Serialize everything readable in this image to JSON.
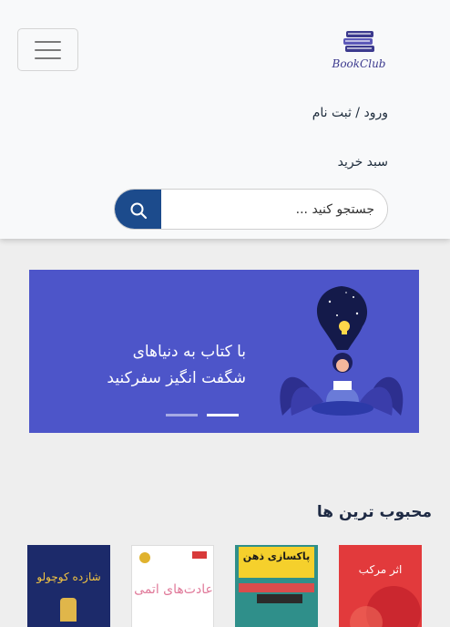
{
  "brand": {
    "logo_text": "BookClub",
    "logo_color": "#3c3a8e"
  },
  "nav": {
    "login_label": "ورود / ثبت نام",
    "cart_label": "سبد خرید"
  },
  "search": {
    "placeholder": "جستجو کنید ...",
    "value": ""
  },
  "banner": {
    "line1": "با کتاب به دنیاهای",
    "line2": "شگفت انگیز سفرکنید",
    "background": "#4d55c9",
    "slide_count": 2,
    "active_slide": 2
  },
  "section": {
    "title": "محبوب ترین ها"
  },
  "books": [
    {
      "title": "اثر مرکب",
      "cover_color": "#e23a3c"
    },
    {
      "title": "پاکسازی ذهن",
      "cover_color": "#2f8f8a"
    },
    {
      "title": "عادت‌های اتمی",
      "cover_color": "#ffffff"
    },
    {
      "title": "شازده کوچولو",
      "cover_color": "#1c2a6a"
    }
  ],
  "colors": {
    "search_button": "#1c4b8c",
    "navbar_bg": "#f8f9fa",
    "page_bg": "#eeeeee"
  }
}
